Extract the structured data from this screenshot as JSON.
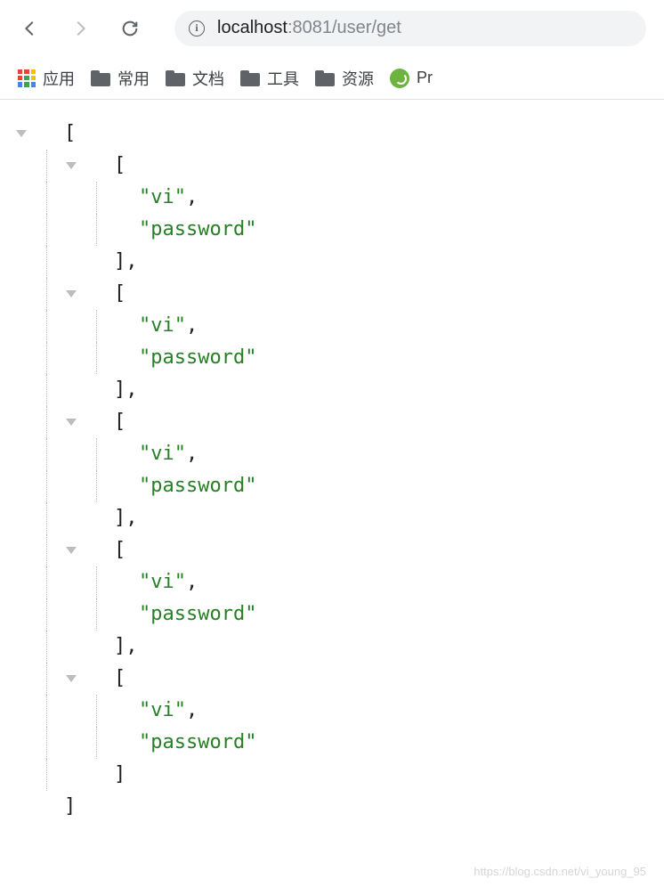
{
  "toolbar": {
    "url_host": "localhost",
    "url_rest": ":8081/user/get"
  },
  "bookmarks": {
    "apps_label": "应用",
    "folders": [
      "常用",
      "文档",
      "工具",
      "资源"
    ],
    "spring_label": "Pr"
  },
  "json": {
    "items": [
      [
        "vi",
        "password"
      ],
      [
        "vi",
        "password"
      ],
      [
        "vi",
        "password"
      ],
      [
        "vi",
        "password"
      ],
      [
        "vi",
        "password"
      ]
    ]
  },
  "watermark": "https://blog.csdn.net/vi_young_95"
}
